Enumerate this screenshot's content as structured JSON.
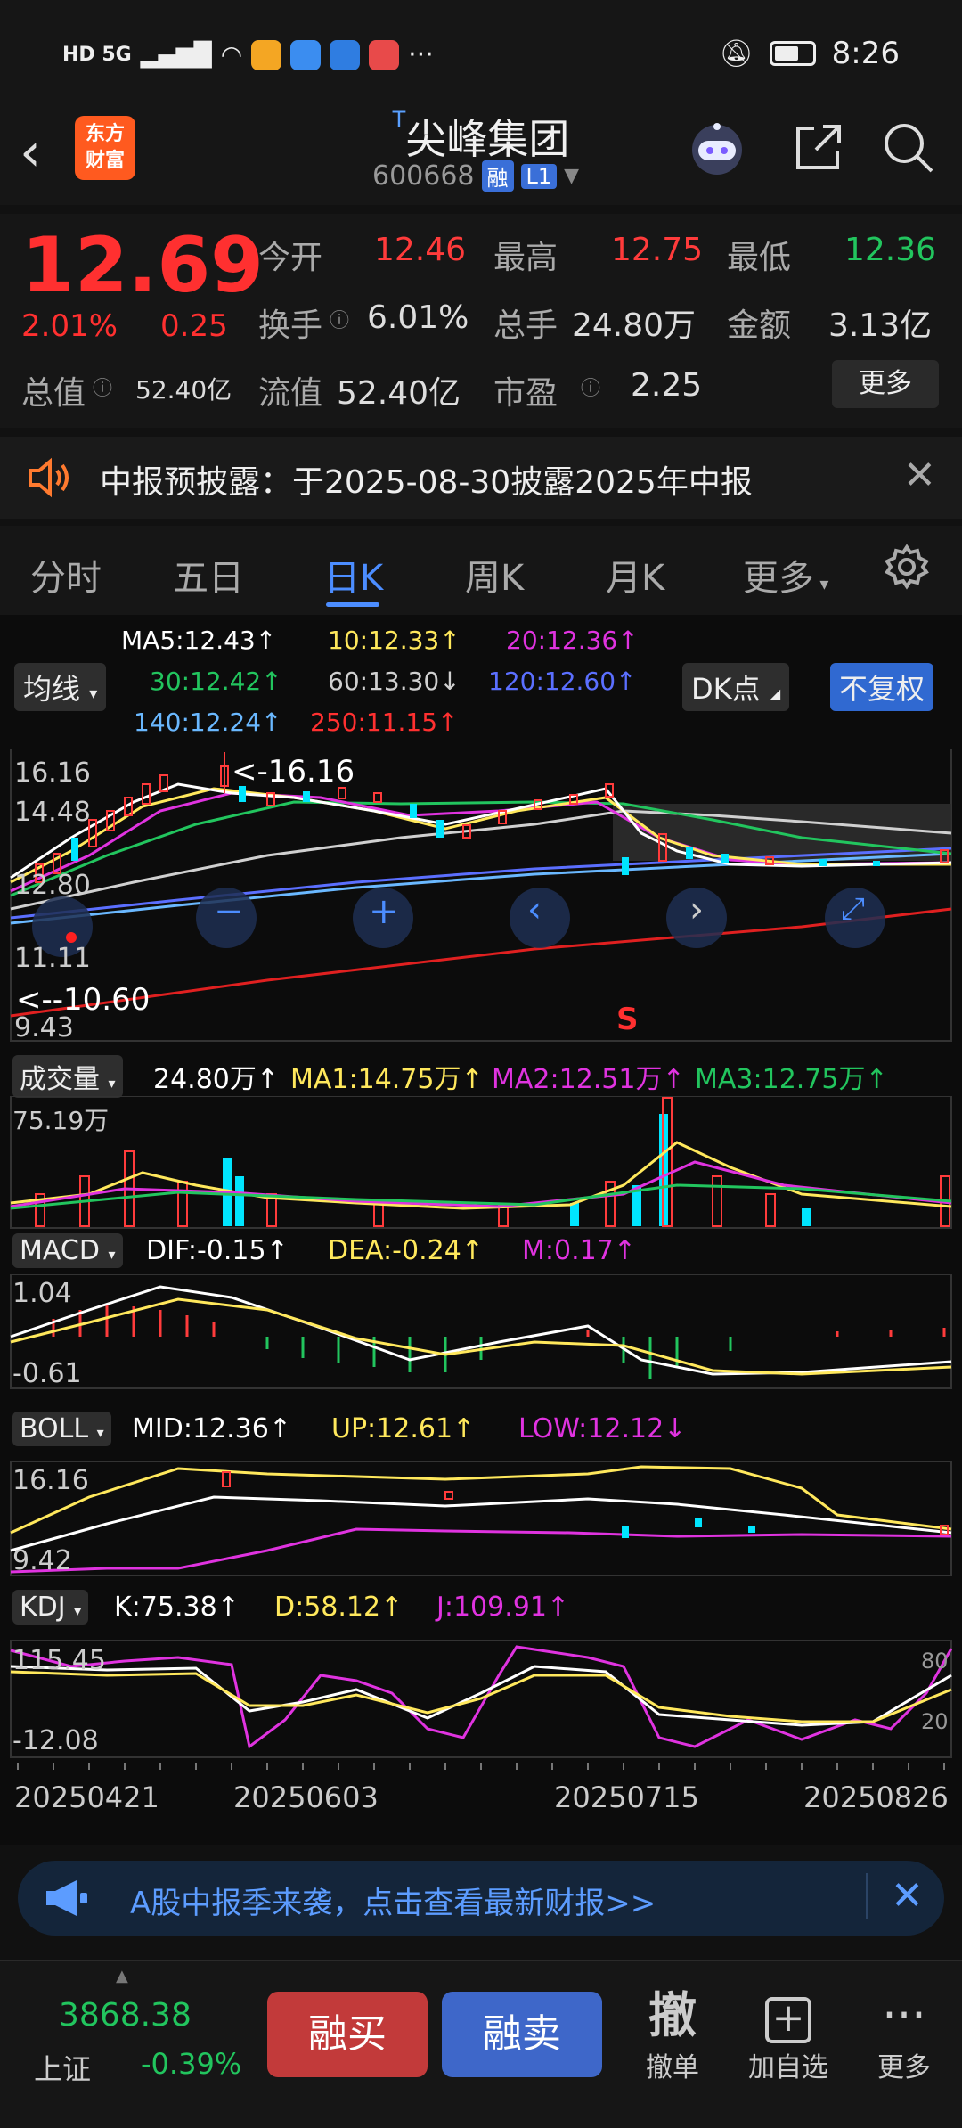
{
  "status_bar": {
    "left_text": "HD 5G",
    "time": "8:26"
  },
  "header": {
    "logo": "东方财富",
    "stock_prefix": "T",
    "stock_name": "尖峰集团",
    "stock_code": "600668",
    "badge_rong": "融",
    "badge_level": "L1"
  },
  "quote": {
    "price": "12.69",
    "change_pct": "2.01%",
    "change": "0.25",
    "rows": [
      [
        {
          "label": "今开",
          "value": "12.46",
          "color": "#ff3b3b"
        },
        {
          "label": "最高",
          "value": "12.75",
          "color": "#ff3b3b"
        },
        {
          "label": "最低",
          "value": "12.36",
          "color": "#22c55e"
        }
      ],
      [
        {
          "label": "换手",
          "value": "6.01%",
          "color": "#eeeeee"
        },
        {
          "label": "总手",
          "value": "24.80万",
          "color": "#eeeeee"
        },
        {
          "label": "金额",
          "value": "3.13亿",
          "color": "#eeeeee"
        }
      ],
      [
        {
          "label": "总值",
          "value": "52.40亿",
          "color": "#eeeeee"
        },
        {
          "label": "流值",
          "value": "52.40亿",
          "color": "#eeeeee"
        },
        {
          "label": "市盈",
          "value": "2.25",
          "color": "#eeeeee"
        }
      ]
    ],
    "more": "更多"
  },
  "notice": {
    "text": "中报预披露：于2025-08-30披露2025年中报"
  },
  "tabs": [
    "分时",
    "五日",
    "日K",
    "周K",
    "月K",
    "更多"
  ],
  "active_tab": "日K",
  "ma": {
    "ma5": "MA5:12.43↑",
    "ma10": "10:12.33↑",
    "ma20": "20:12.36↑",
    "ma30": "30:12.42↑",
    "ma60": "60:13.30↓",
    "ma120": "120:12.60↑",
    "ma140": "140:12.24↑",
    "ma250": "250:11.15↑",
    "junxian": "均线",
    "dk": "DK点",
    "fq": "不复权"
  },
  "colors": {
    "up": "#ff3b3b",
    "down": "#00e5ff",
    "ma5": "#ffffff",
    "ma10": "#ffe85c",
    "ma20": "#e033e0",
    "ma30": "#22c55e",
    "ma60": "#d0d0d0",
    "ma120": "#5b6fff",
    "ma140": "#6ab8ff",
    "ma250": "#e02020"
  },
  "main_axis": {
    "high_label": "16.16",
    "v2": "14.48",
    "v3": "12.80",
    "v4": "11.11",
    "low_label": "9.43",
    "max_mark": "<-16.16",
    "min_mark": "<--10.60",
    "s_mark": "S"
  },
  "volume": {
    "label": "成交量",
    "value": "24.80万↑",
    "ma1": "MA1:14.75万↑",
    "ma2": "MA2:12.51万↑",
    "ma3": "MA3:12.75万↑",
    "axis_top": "75.19万"
  },
  "macd": {
    "label": "MACD",
    "dif": "DIF:-0.15↑",
    "dea": "DEA:-0.24↑",
    "m": "M:0.17↑",
    "axis_top": "1.04",
    "axis_bottom": "-0.61"
  },
  "boll": {
    "label": "BOLL",
    "mid": "MID:12.36↑",
    "up": "UP:12.61↑",
    "low": "LOW:12.12↓",
    "axis_top": "16.16",
    "axis_bottom": "9.42"
  },
  "kdj": {
    "label": "KDJ",
    "k": "K:75.38↑",
    "d": "D:58.12↑",
    "j": "J:109.91↑",
    "axis_top": "115.45",
    "axis_bottom": "-12.08",
    "r80": "80",
    "r20": "20"
  },
  "dates": [
    "20250421",
    "20250603",
    "20250715",
    "20250826"
  ],
  "banner": {
    "text": "A股中报季来袭，点击查看最新财报>>"
  },
  "bottom": {
    "index_value": "3868.38",
    "index_name": "上证",
    "index_change": "-0.39%",
    "buy": "融买",
    "sell": "融卖",
    "cancel_icon": "撤",
    "cancel": "撤单",
    "add": "加自选",
    "more": "更多"
  }
}
